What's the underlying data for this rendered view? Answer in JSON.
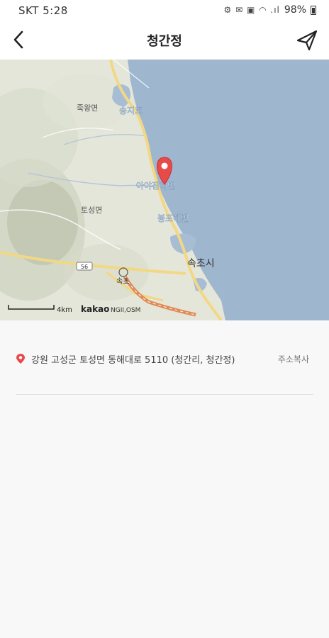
{
  "status_bar": {
    "carrier_time": "SKT 5:28",
    "icons": "⚙ ✉ ▣ ◠ .ıl",
    "battery": "98%"
  },
  "header": {
    "title": "청간정",
    "back_icon": "chevron-left-icon",
    "nav_icon": "send-arrow-icon"
  },
  "map": {
    "labels": {
      "jugwang": "죽왕면",
      "songjiho": "송지호",
      "ayajin": "아야진해변",
      "toseong": "토성면",
      "bongpo": "봉포해변",
      "sokcho_city": "속초시",
      "sokcho_ic": "속초",
      "route_shield": "56"
    },
    "scale": "4km",
    "attribution_brand": "kakao",
    "attribution_sources": "NGII,OSM",
    "colors": {
      "sea": "#9fb6cf",
      "land": "#e4e6da",
      "road": "#f2d884",
      "highway": "#e08a55",
      "marker": "#e84a4a"
    }
  },
  "address": {
    "text": "강원 고성군 토성면 동해대로 5110 (청간리, 청간정)",
    "copy_label": "주소복사"
  }
}
